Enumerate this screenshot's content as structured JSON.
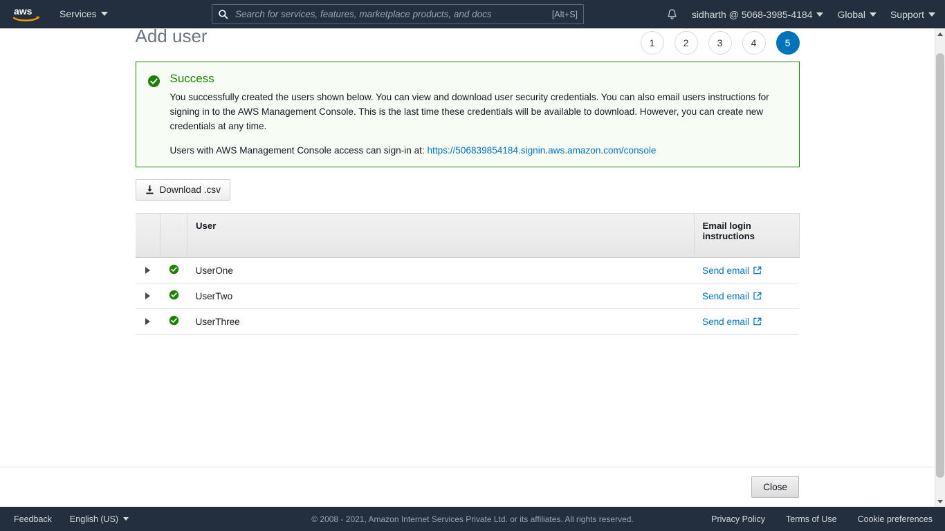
{
  "topnav": {
    "logo_label": "aws",
    "services_label": "Services",
    "search": {
      "placeholder": "Search for services, features, marketplace products, and docs",
      "value": "",
      "shortcut": "[Alt+S]"
    },
    "account_label": "sidharth @ 5068-3985-4184",
    "region_label": "Global",
    "support_label": "Support"
  },
  "page": {
    "title": "Add user",
    "steps": [
      {
        "label": "1",
        "active": false
      },
      {
        "label": "2",
        "active": false
      },
      {
        "label": "3",
        "active": false
      },
      {
        "label": "4",
        "active": false
      },
      {
        "label": "5",
        "active": true
      }
    ]
  },
  "alert": {
    "icon": "success-check-icon",
    "title": "Success",
    "body": "You successfully created the users shown below. You can view and download user security credentials. You can also email users instructions for signing in to the AWS Management Console. This is the last time these credentials will be available to download. However, you can create new credentials at any time.",
    "signin_prefix": "Users with AWS Management Console access can sign-in at:",
    "signin_url": "https://506839854184.signin.aws.amazon.com/console",
    "border_color": "#1d8102",
    "background_color": "#f7fcf5",
    "title_color": "#1d8102"
  },
  "toolbar": {
    "download_label": "Download .csv",
    "download_icon": "download-icon"
  },
  "table": {
    "columns": [
      "",
      "",
      "User",
      "Email login instructions"
    ],
    "rows": [
      {
        "user": "UserOne",
        "status": "success",
        "email_link": "Send email"
      },
      {
        "user": "UserTwo",
        "status": "success",
        "email_link": "Send email"
      },
      {
        "user": "UserThree",
        "status": "success",
        "email_link": "Send email"
      }
    ]
  },
  "actions": {
    "close_label": "Close"
  },
  "footer": {
    "feedback_label": "Feedback",
    "language_label": "English (US)",
    "copyright": "© 2008 - 2021, Amazon Internet Services Private Ltd. or its affiliates. All rights reserved.",
    "privacy_label": "Privacy Policy",
    "terms_label": "Terms of Use",
    "cookie_label": "Cookie preferences"
  },
  "colors": {
    "nav_bg": "#232f3e",
    "accent_blue": "#0073bb",
    "success_green": "#1d8102",
    "link_blue": "#0073bb"
  }
}
